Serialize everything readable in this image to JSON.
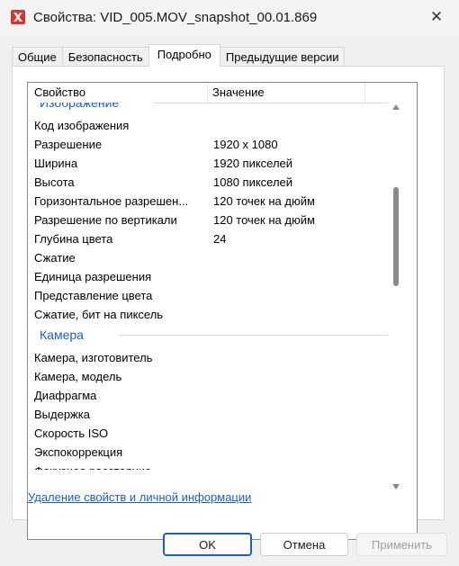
{
  "window": {
    "title": "Свойства: VID_005.MOV_snapshot_00.01.869",
    "close_symbol": "✕"
  },
  "tabs": [
    {
      "label": "Общие"
    },
    {
      "label": "Безопасность"
    },
    {
      "label": "Подробно"
    },
    {
      "label": "Предыдущие версии"
    }
  ],
  "details": {
    "col_property": "Свойство",
    "col_value": "Значение",
    "group_image_partial": "Изображение",
    "image_rows": [
      {
        "k": "Код изображения",
        "v": ""
      },
      {
        "k": "Разрешение",
        "v": "1920 x 1080"
      },
      {
        "k": "Ширина",
        "v": "1920 пикселей"
      },
      {
        "k": "Высота",
        "v": "1080 пикселей"
      },
      {
        "k": "Горизонтальное разрешен...",
        "v": "120 точек на дюйм"
      },
      {
        "k": "Разрешение по вертикали",
        "v": "120 точек на дюйм"
      },
      {
        "k": "Глубина цвета",
        "v": "24"
      },
      {
        "k": "Сжатие",
        "v": ""
      },
      {
        "k": "Единица разрешения",
        "v": ""
      },
      {
        "k": "Представление цвета",
        "v": ""
      },
      {
        "k": "Сжатие, бит на пиксель",
        "v": ""
      }
    ],
    "group_camera": "Камера",
    "camera_rows": [
      {
        "k": "Камера, изготовитель",
        "v": ""
      },
      {
        "k": "Камера, модель",
        "v": ""
      },
      {
        "k": "Диафрагма",
        "v": ""
      },
      {
        "k": "Выдержка",
        "v": ""
      },
      {
        "k": "Скорость ISO",
        "v": ""
      },
      {
        "k": "Экспокоррекция",
        "v": ""
      },
      {
        "k": "Фокусное расстояние",
        "v": ""
      }
    ]
  },
  "remove_link": "Удаление свойств и личной информации",
  "buttons": {
    "ok": "OK",
    "cancel": "Отмена",
    "apply": "Применить"
  },
  "colors": {
    "accent": "#1a5ec8",
    "app_icon": "#d8322c"
  }
}
